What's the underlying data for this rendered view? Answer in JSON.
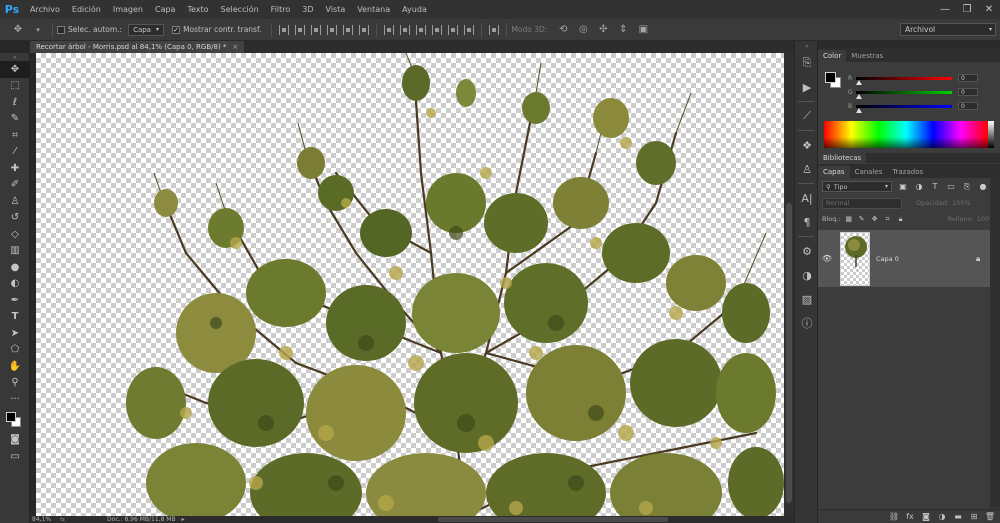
{
  "app": {
    "logo": "Ps",
    "menu": [
      "Archivo",
      "Edición",
      "Imagen",
      "Capa",
      "Texto",
      "Selección",
      "Filtro",
      "3D",
      "Vista",
      "Ventana",
      "Ayuda"
    ]
  },
  "window_controls": [
    "—",
    "❐",
    "✕"
  ],
  "options_bar": {
    "auto_select_label": "Selec. autom.:",
    "auto_select_checked": false,
    "layer_select_value": "Capa",
    "show_transform_label": "Mostrar contr. transf.",
    "show_transform_checked": true,
    "mode_3d_label": "Modo 3D:",
    "workspace_value": "Archivol"
  },
  "document": {
    "tab_title": "Recortar árbol - Morris.psd al 84,1% (Capa 0, RGB/8) *",
    "zoom": "84,1%",
    "doc_size": "Doc.: 8,96 MB/11,8 MB"
  },
  "tools": [
    "move-tool",
    "marquee-tool",
    "lasso-tool",
    "quick-select-tool",
    "crop-tool",
    "eyedropper-tool",
    "healing-brush-tool",
    "brush-tool",
    "clone-stamp-tool",
    "history-brush-tool",
    "eraser-tool",
    "gradient-tool",
    "blur-tool",
    "dodge-tool",
    "pen-tool",
    "type-tool",
    "path-select-tool",
    "shape-tool",
    "hand-tool",
    "zoom-tool"
  ],
  "colors": {
    "foreground": "#000000",
    "background": "#ffffff",
    "accent": "#31a8ff"
  },
  "color_panel": {
    "tabs": [
      "Color",
      "Muestras"
    ],
    "active_tab": "Color",
    "sliders": [
      {
        "label": "R",
        "value": "0"
      },
      {
        "label": "G",
        "value": "0"
      },
      {
        "label": "B",
        "value": "0"
      }
    ]
  },
  "libraries_panel": {
    "tabs": [
      "Bibliotecas"
    ]
  },
  "layers_panel": {
    "tabs": [
      "Capas",
      "Canales",
      "Trazados"
    ],
    "active_tab": "Capas",
    "filter_kind": "Tipo",
    "blend_mode": "Normal",
    "opacity_label": "Opacidad:",
    "opacity_value": "100%",
    "lock_label": "Bloq.:",
    "fill_label": "Relleno:",
    "fill_value": "100%",
    "layers": [
      {
        "name": "Capa 0",
        "visible": true,
        "locked": false
      }
    ]
  }
}
